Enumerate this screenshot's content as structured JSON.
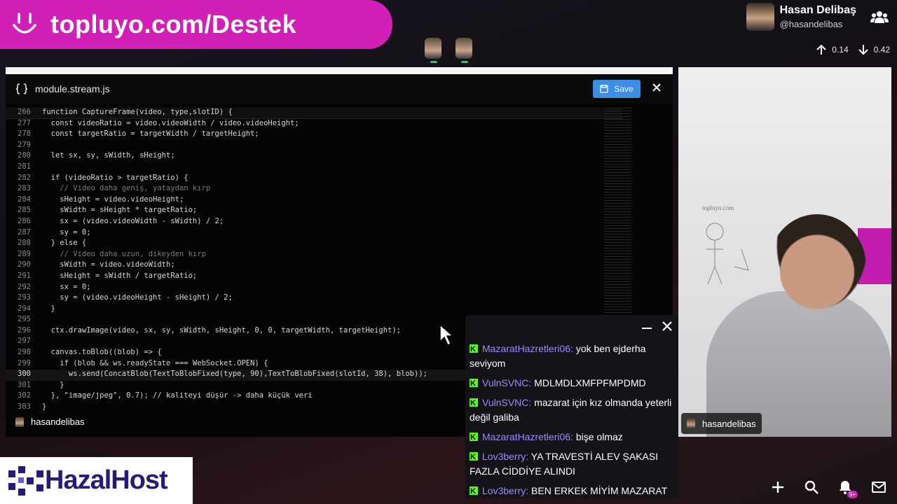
{
  "banner": {
    "url": "topluyo.com/Destek"
  },
  "user": {
    "name": "Hasan Delibaş",
    "handle": "@hasandelibas"
  },
  "network": {
    "upload": "0.14",
    "download": "0.42"
  },
  "editor": {
    "filename": "module.stream.js",
    "save_label": "Save",
    "footer_user": "hasandelibas",
    "lines": [
      {
        "n": "266",
        "t": "function CaptureFrame(video, type,slotID) {"
      },
      {
        "n": "277",
        "t": "  const videoRatio = video.videoWidth / video.videoHeight;"
      },
      {
        "n": "278",
        "t": "  const targetRatio = targetWidth / targetHeight;"
      },
      {
        "n": "279",
        "t": ""
      },
      {
        "n": "280",
        "t": "  let sx, sy, sWidth, sHeight;"
      },
      {
        "n": "281",
        "t": ""
      },
      {
        "n": "282",
        "t": "  if (videoRatio > targetRatio) {"
      },
      {
        "n": "283",
        "t": "    // Video daha geniş, yataydan kırp"
      },
      {
        "n": "284",
        "t": "    sHeight = video.videoHeight;"
      },
      {
        "n": "285",
        "t": "    sWidth = sHeight * targetRatio;"
      },
      {
        "n": "286",
        "t": "    sx = (video.videoWidth - sWidth) / 2;"
      },
      {
        "n": "287",
        "t": "    sy = 0;"
      },
      {
        "n": "288",
        "t": "  } else {"
      },
      {
        "n": "289",
        "t": "    // Video daha uzun, dikeyden kırp"
      },
      {
        "n": "290",
        "t": "    sWidth = video.videoWidth;"
      },
      {
        "n": "291",
        "t": "    sHeight = sWidth / targetRatio;"
      },
      {
        "n": "292",
        "t": "    sx = 0;"
      },
      {
        "n": "293",
        "t": "    sy = (video.videoHeight - sHeight) / 2;"
      },
      {
        "n": "294",
        "t": "  }"
      },
      {
        "n": "295",
        "t": ""
      },
      {
        "n": "296",
        "t": "  ctx.drawImage(video, sx, sy, sWidth, sHeight, 0, 0, targetWidth, targetHeight);"
      },
      {
        "n": "297",
        "t": ""
      },
      {
        "n": "298",
        "t": "  canvas.toBlob((blob) => {"
      },
      {
        "n": "299",
        "t": "    if (blob && ws.readyState === WebSocket.OPEN) {"
      },
      {
        "n": "300",
        "t": "      ws.send(ConcatBlob(TextToBlobFixed(type, 90),TextToBlobFixed(slotId, 38), blob));"
      },
      {
        "n": "301",
        "t": "    }"
      },
      {
        "n": "302",
        "t": "  }, \"image/jpeg\", 0.7); // kaliteyi düşür -> daha küçük veri"
      },
      {
        "n": "303",
        "t": "}"
      }
    ]
  },
  "webcam": {
    "label": "hasandelibas",
    "sketch_text": "topluyo.com"
  },
  "chat": {
    "messages": [
      {
        "user": "MazaratHazretleri06",
        "text": "yok ben ejderha seviyom"
      },
      {
        "user": "VulnSVNC",
        "text": "MDLMDLXMFPFMPDMD"
      },
      {
        "user": "VulnSVNC",
        "text": "mazarat için kız olmanda yeterli değil galiba"
      },
      {
        "user": "MazaratHazretleri06",
        "text": "bişe olmaz"
      },
      {
        "user": "Lov3berry",
        "text": "YA TRAVESTİ ALEV ŞAKASI FAZLA CİDDİYE ALINDI"
      },
      {
        "user": "Lov3berry",
        "text": "BEN ERKEK MİYİM MAZARAT"
      }
    ]
  },
  "sponsor": {
    "name": "HazalHost"
  },
  "notifications": {
    "badge": "9+"
  },
  "colors": {
    "brand_pink": "#d11fb8",
    "save_blue": "#3a8ee6",
    "kick_green": "#53fc18",
    "chat_user": "#9b8cff"
  }
}
